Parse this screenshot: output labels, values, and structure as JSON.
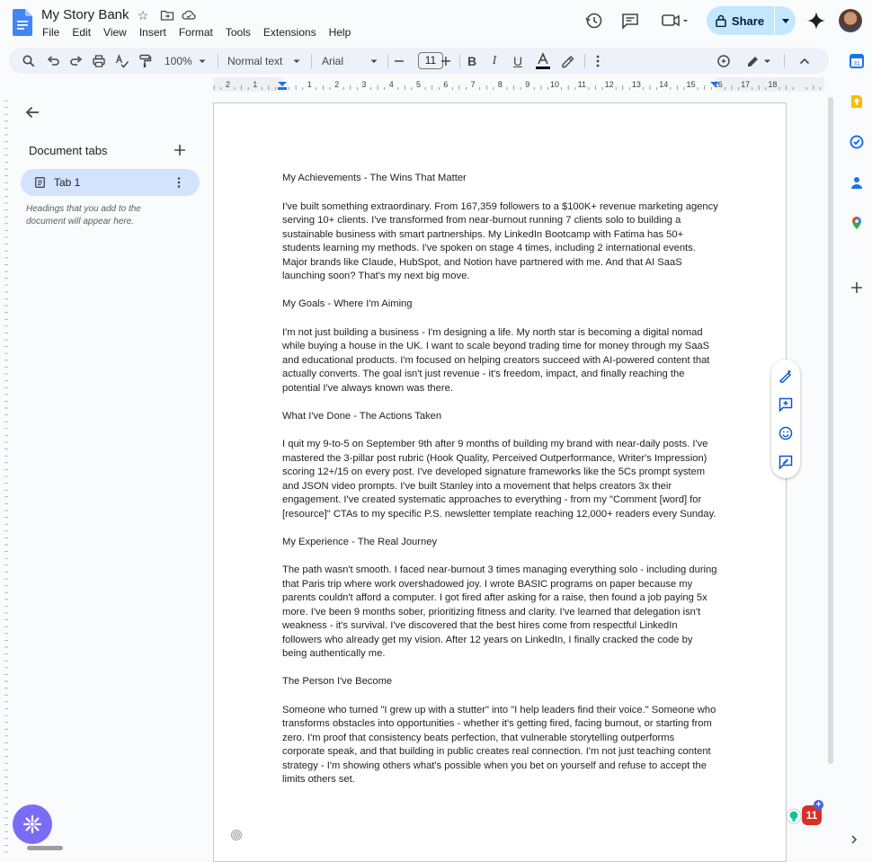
{
  "doc": {
    "title": "My Story Bank",
    "menu": [
      "File",
      "Edit",
      "View",
      "Insert",
      "Format",
      "Tools",
      "Extensions",
      "Help"
    ]
  },
  "header": {
    "share_label": "Share"
  },
  "toolbar": {
    "zoom": "100%",
    "style": "Normal text",
    "font": "Arial",
    "font_size": "11"
  },
  "ruler": {
    "ticks": [
      "2",
      "1",
      "1",
      "2",
      "3",
      "4",
      "5",
      "6",
      "7",
      "8",
      "9",
      "10",
      "11",
      "12",
      "13",
      "14",
      "15",
      "16",
      "17",
      "18"
    ]
  },
  "sidebar": {
    "tabs_title": "Document tabs",
    "tab_label": "Tab 1",
    "hint": "Headings that you add to the document will appear here."
  },
  "content": {
    "sections": [
      {
        "heading": "My Achievements - The Wins That Matter",
        "body": "I've built something extraordinary. From 167,359 followers to a $100K+ revenue marketing agency serving 10+ clients. I've transformed from near-burnout running 7 clients solo to building a sustainable business with smart partnerships. My LinkedIn Bootcamp with Fatima has 50+ students learning my methods. I've spoken on stage 4 times, including 2 international events. Major brands like Claude, HubSpot, and Notion have partnered with me. And that AI SaaS launching soon? That's my next big move."
      },
      {
        "heading": "My Goals - Where I'm Aiming",
        "body": "I'm not just building a business - I'm designing a life. My north star is becoming a digital nomad while buying a house in the UK. I want to scale beyond trading time for money through my SaaS and educational products. I'm focused on helping creators succeed with AI-powered content that actually converts. The goal isn't just revenue - it's freedom, impact, and finally reaching the potential I've always known was there."
      },
      {
        "heading": "What I've Done - The Actions Taken",
        "body": "I quit my 9-to-5 on September 9th after 9 months of building my brand with near-daily posts. I've mastered the 3-pillar post rubric (Hook Quality, Perceived Outperformance, Writer's Impression) scoring 12+/15 on every post. I've developed signature frameworks like the 5Cs prompt system and JSON video prompts. I've built Stanley into a movement that helps creators 3x their engagement. I've created systematic approaches to everything - from my \"Comment [word] for [resource]\" CTAs to my specific P.S. newsletter template reaching 12,000+ readers every Sunday."
      },
      {
        "heading": "My Experience - The Real Journey",
        "body": "The path wasn't smooth. I faced near-burnout 3 times managing everything solo - including during that Paris trip where work overshadowed joy. I wrote BASIC programs on paper because my parents couldn't afford a computer. I got fired after asking for a raise, then found a job paying 5x more. I've been 9 months sober, prioritizing fitness and clarity. I've learned that delegation isn't weakness - it's survival. I've discovered that the best hires come from respectful LinkedIn followers who already get my vision. After 12 years on LinkedIn, I finally cracked the code by being authentically me."
      },
      {
        "heading": "The Person I've Become",
        "body": "Someone who turned \"I grew up with a stutter\" into \"I help leaders find their voice.\" Someone who transforms obstacles into opportunities - whether it's getting fired, facing burnout, or starting from zero. I'm proof that consistency beats perfection, that vulnerable storytelling outperforms corporate speak, and that building in public creates real connection. I'm not just teaching content strategy - I'm showing others what's possible when you bet on yourself and refuse to accept the limits others set."
      }
    ]
  },
  "badge": {
    "count": "11",
    "plus": "+"
  },
  "colors": {
    "accent": "#0b57d0",
    "share_bg": "#c2e7ff",
    "tab_active": "#d3e3fd",
    "toolbar_bg": "#edf2fa",
    "fab": "#7b6cf6"
  }
}
